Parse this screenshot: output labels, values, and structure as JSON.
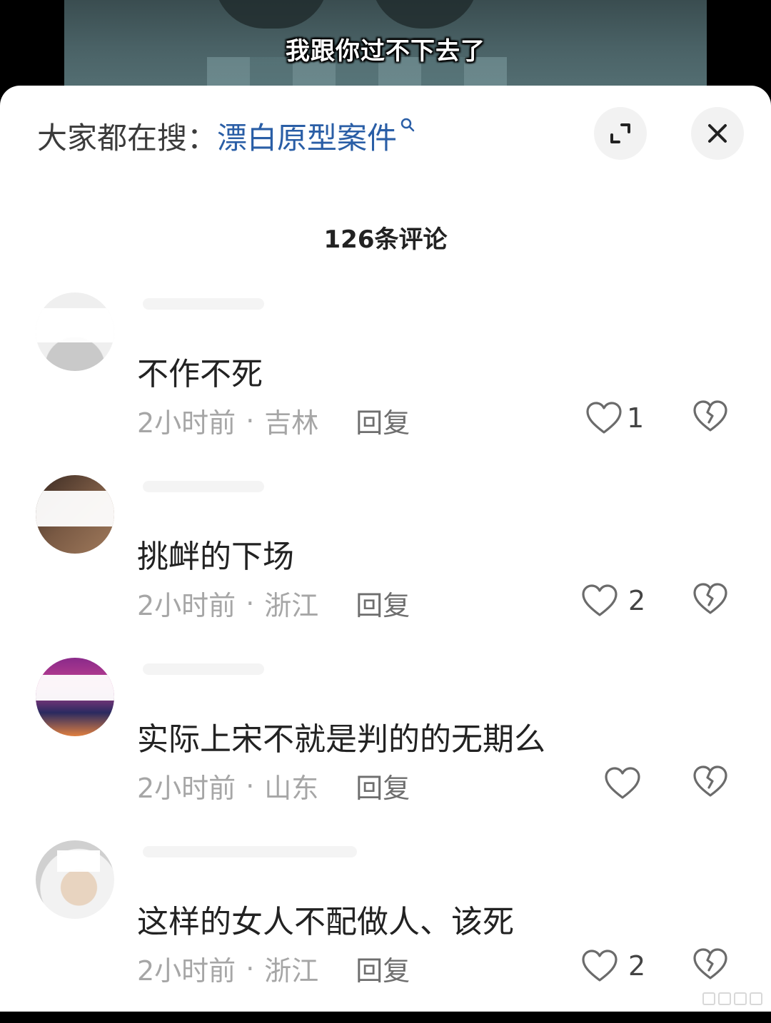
{
  "video": {
    "subtitle": "我跟你过不下去了"
  },
  "header": {
    "search_prefix": "大家都在搜：",
    "search_term": "漂白原型案件",
    "search_icon": "search-icon",
    "expand_icon": "expand-icon",
    "close_icon": "close-icon"
  },
  "comment_count": "126条评论",
  "comments": [
    {
      "text": "不作不死",
      "time": "2小时前",
      "location": "吉林",
      "reply": "回复",
      "likes": "1"
    },
    {
      "text": "挑衅的下场",
      "time": "2小时前",
      "location": "浙江",
      "reply": "回复",
      "likes": "2"
    },
    {
      "text": "实际上宋不就是判的的无期么",
      "time": "2小时前",
      "location": "山东",
      "reply": "回复",
      "likes": ""
    },
    {
      "text": "这样的女人不配做人、该死",
      "time": "2小时前",
      "location": "浙江",
      "reply": "回复",
      "likes": "2"
    }
  ],
  "separator": "·",
  "colors": {
    "accent_link": "#2a5ea6",
    "meta_gray": "#a6a6a6",
    "icon_gray": "#6b6b6b"
  }
}
